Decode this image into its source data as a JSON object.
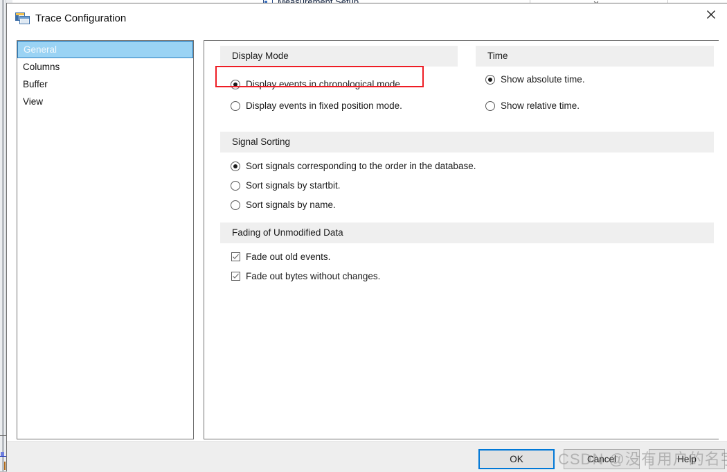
{
  "background_window": {
    "title": "Measurement Setup",
    "icon": "window-icon",
    "minimize_label": "–",
    "maximize_label": "□",
    "close_label": "✕"
  },
  "dialog": {
    "title": "Trace Configuration",
    "icon": "trace-configuration-icon",
    "close_label": "✕"
  },
  "sidebar": {
    "items": [
      {
        "label": "General",
        "selected": true
      },
      {
        "label": "Columns",
        "selected": false
      },
      {
        "label": "Buffer",
        "selected": false
      },
      {
        "label": "View",
        "selected": false
      }
    ]
  },
  "groups": {
    "display_mode": {
      "header": "Display Mode",
      "options": [
        {
          "label": "Display events in chronological mode.",
          "checked": true
        },
        {
          "label": "Display events in fixed position mode.",
          "checked": false
        }
      ]
    },
    "time": {
      "header": "Time",
      "options": [
        {
          "label": "Show absolute time.",
          "checked": true
        },
        {
          "label": "Show relative time.",
          "checked": false
        }
      ]
    },
    "signal_sorting": {
      "header": "Signal Sorting",
      "options": [
        {
          "label": "Sort signals corresponding to the order in the database.",
          "checked": true
        },
        {
          "label": "Sort signals by startbit.",
          "checked": false
        },
        {
          "label": "Sort signals by name.",
          "checked": false
        }
      ]
    },
    "fading": {
      "header": "Fading of Unmodified Data",
      "options": [
        {
          "label": "Fade out old events.",
          "checked": true
        },
        {
          "label": "Fade out bytes without changes.",
          "checked": true
        }
      ]
    }
  },
  "footer": {
    "ok_label": "OK",
    "cancel_label": "Cancel",
    "help_label": "Help"
  },
  "annotation": {
    "color": "#ee1c24",
    "target": "Display events in chronological mode."
  },
  "watermark": {
    "text": "CSDN @没有用户的名字"
  },
  "colors": {
    "selection_blue": "#9ad3f4",
    "focus_blue": "#0078d7",
    "group_header_gray": "#efefef",
    "annotation_red": "#ee1c24"
  }
}
